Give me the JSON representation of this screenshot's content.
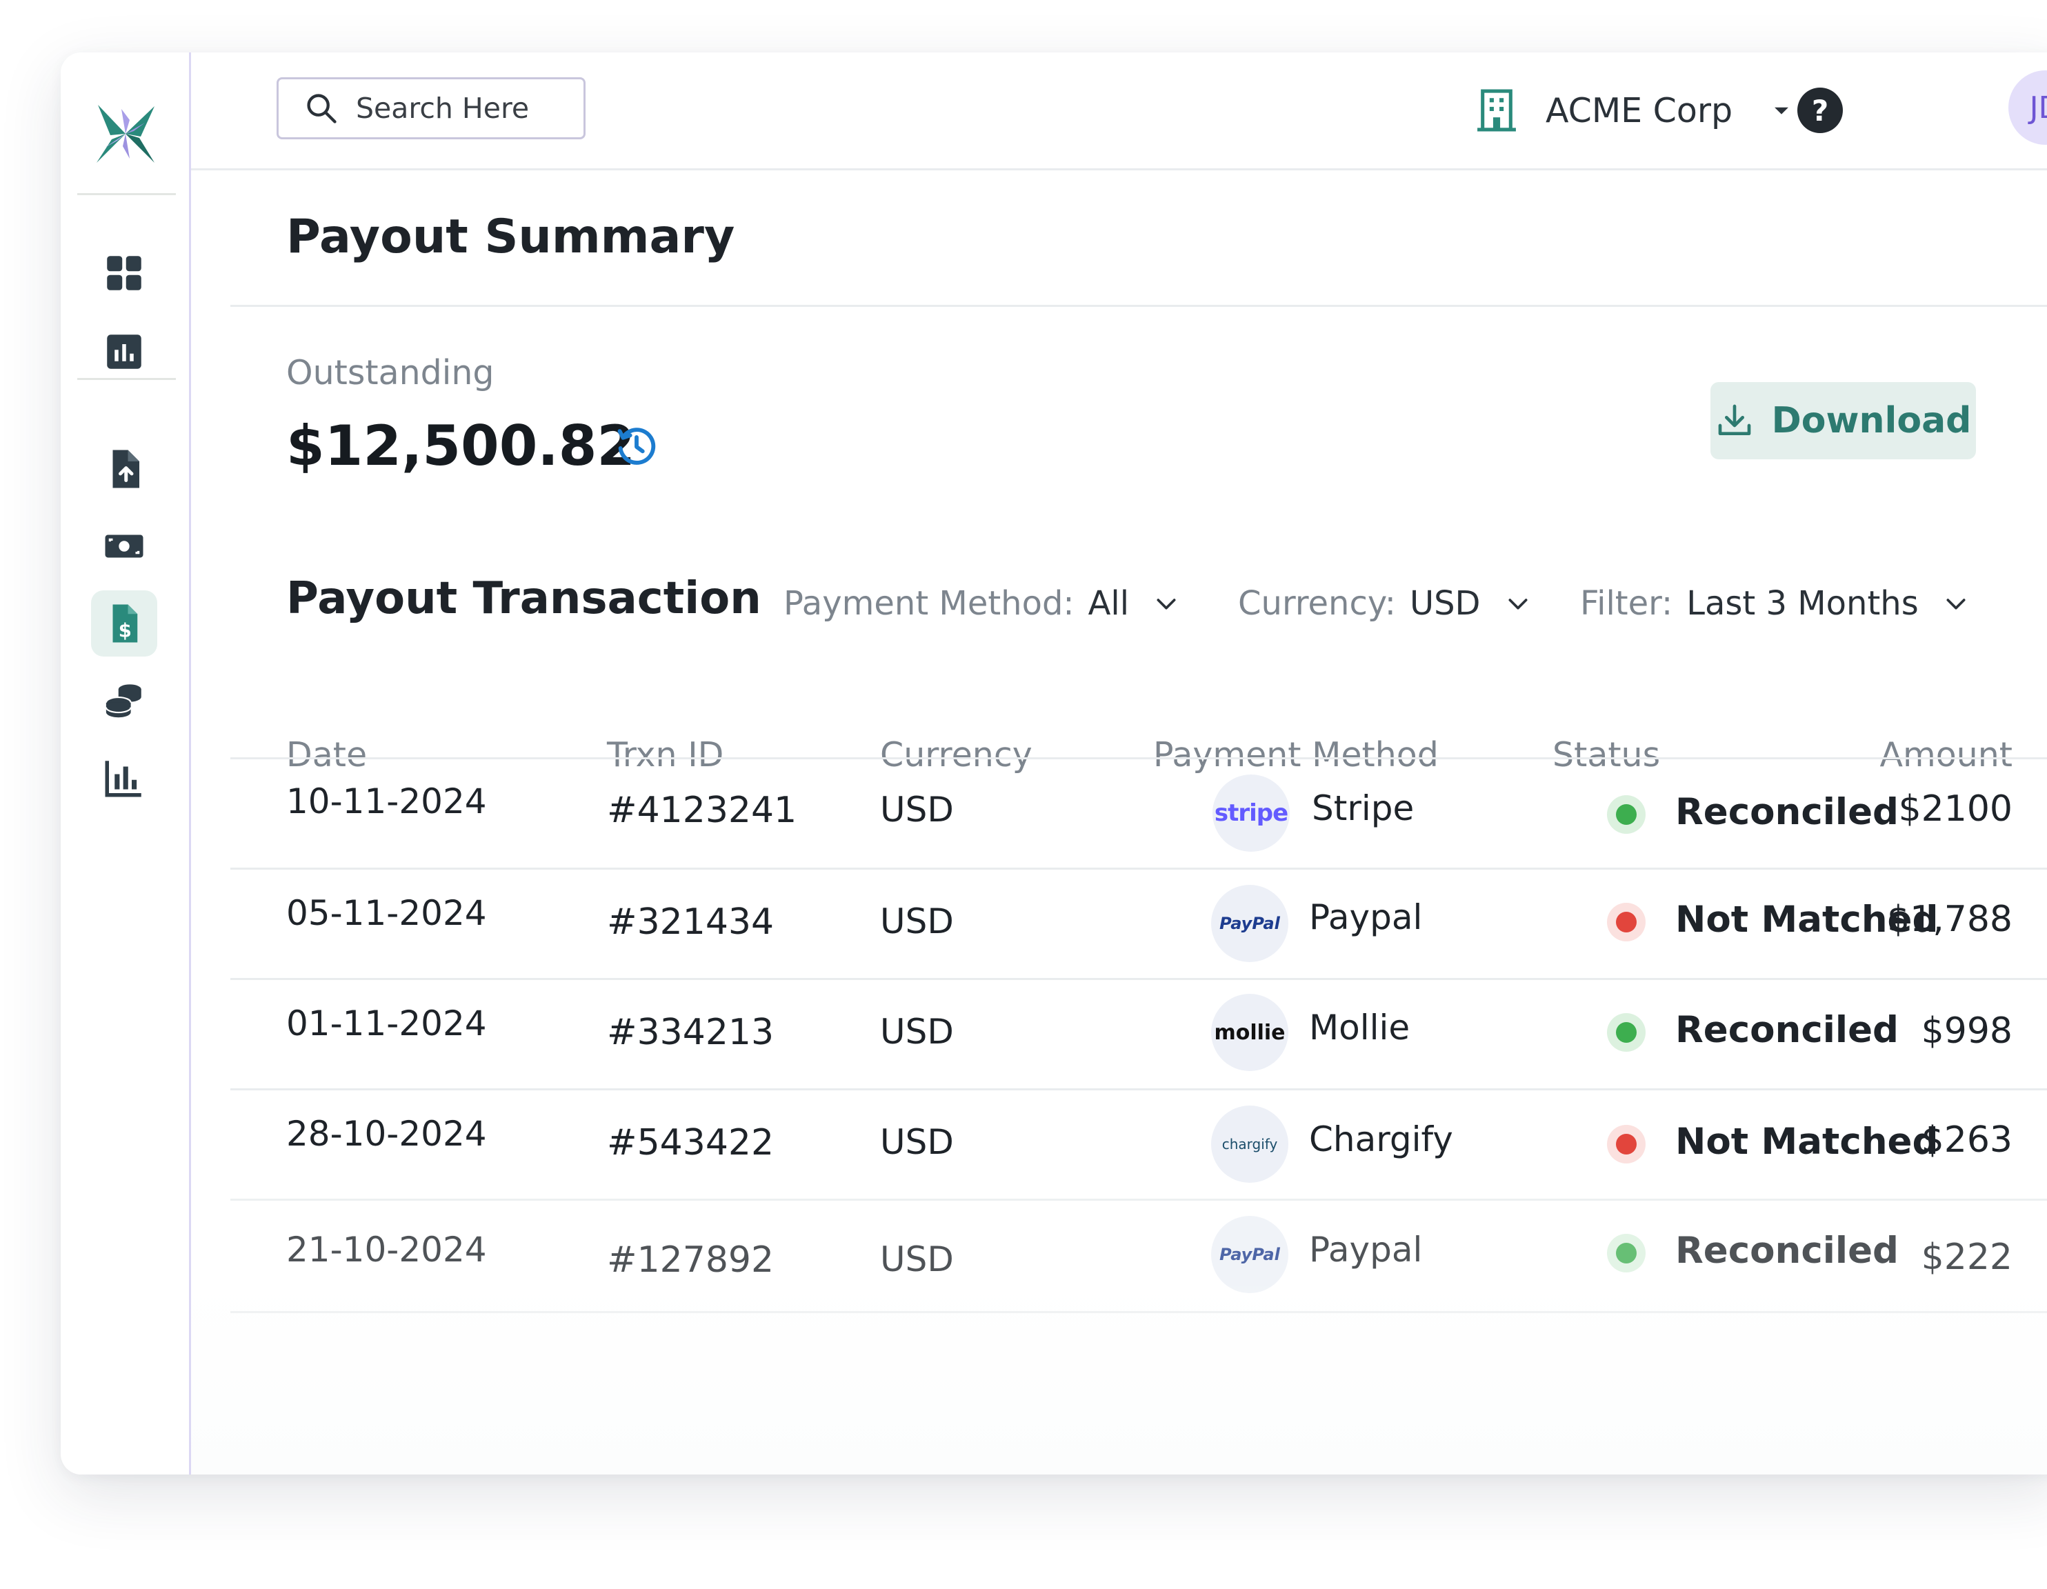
{
  "search": {
    "placeholder": "Search Here"
  },
  "org": {
    "name": "ACME Corp"
  },
  "help": {
    "label": "?"
  },
  "user": {
    "initials": "JD"
  },
  "sidebar": {
    "items": [
      {
        "name": "dashboard",
        "icon": "grid-icon"
      },
      {
        "name": "analytics",
        "icon": "bar-chart-square-icon"
      },
      {
        "name": "upload",
        "icon": "file-upload-icon"
      },
      {
        "name": "cash",
        "icon": "cash-icon"
      },
      {
        "name": "payouts",
        "icon": "invoice-dollar-icon",
        "active": true
      },
      {
        "name": "coins",
        "icon": "coins-icon"
      },
      {
        "name": "reports",
        "icon": "bar-chart-icon"
      }
    ]
  },
  "page": {
    "title": "Payout Summary"
  },
  "outstanding": {
    "label": "Outstanding",
    "amount": "$12,500.82"
  },
  "download": {
    "label": "Download"
  },
  "transactions": {
    "title": "Payout Transaction",
    "filters": [
      {
        "label": "Payment Method:",
        "value": "All"
      },
      {
        "label": "Currency:",
        "value": "USD"
      },
      {
        "label": "Filter:",
        "value": "Last 3 Months"
      }
    ],
    "columns": [
      "Date",
      "Trxn ID",
      "Currency",
      "Payment Method",
      "Status",
      "Amount"
    ],
    "rows": [
      {
        "date": "10-11-2024",
        "id": "#4123241",
        "currency": "USD",
        "method": "Stripe",
        "logo": "stripe",
        "status": "Reconciled",
        "amount": "$2100"
      },
      {
        "date": "05-11-2024",
        "id": "#321434",
        "currency": "USD",
        "method": "Paypal",
        "logo": "PayPal",
        "status": "Not Matched",
        "amount": "$1,788"
      },
      {
        "date": "01-11-2024",
        "id": "#334213",
        "currency": "USD",
        "method": "Mollie",
        "logo": "mollie",
        "status": "Reconciled",
        "amount": "$998"
      },
      {
        "date": "28-10-2024",
        "id": "#543422",
        "currency": "USD",
        "method": "Chargify",
        "logo": "chargify",
        "status": "Not Matched",
        "amount": "$263"
      },
      {
        "date": "21-10-2024",
        "id": "#127892",
        "currency": "USD",
        "method": "Paypal",
        "logo": "PayPal",
        "status": "Reconciled",
        "amount": "$222"
      }
    ]
  },
  "colors": {
    "accent": "#2d7a70",
    "reconciled": "#3dae4f",
    "not_matched": "#e2453c",
    "refresh": "#1c7ccf",
    "avatar_bg": "#e4dffa",
    "avatar_text": "#6e56d4"
  }
}
